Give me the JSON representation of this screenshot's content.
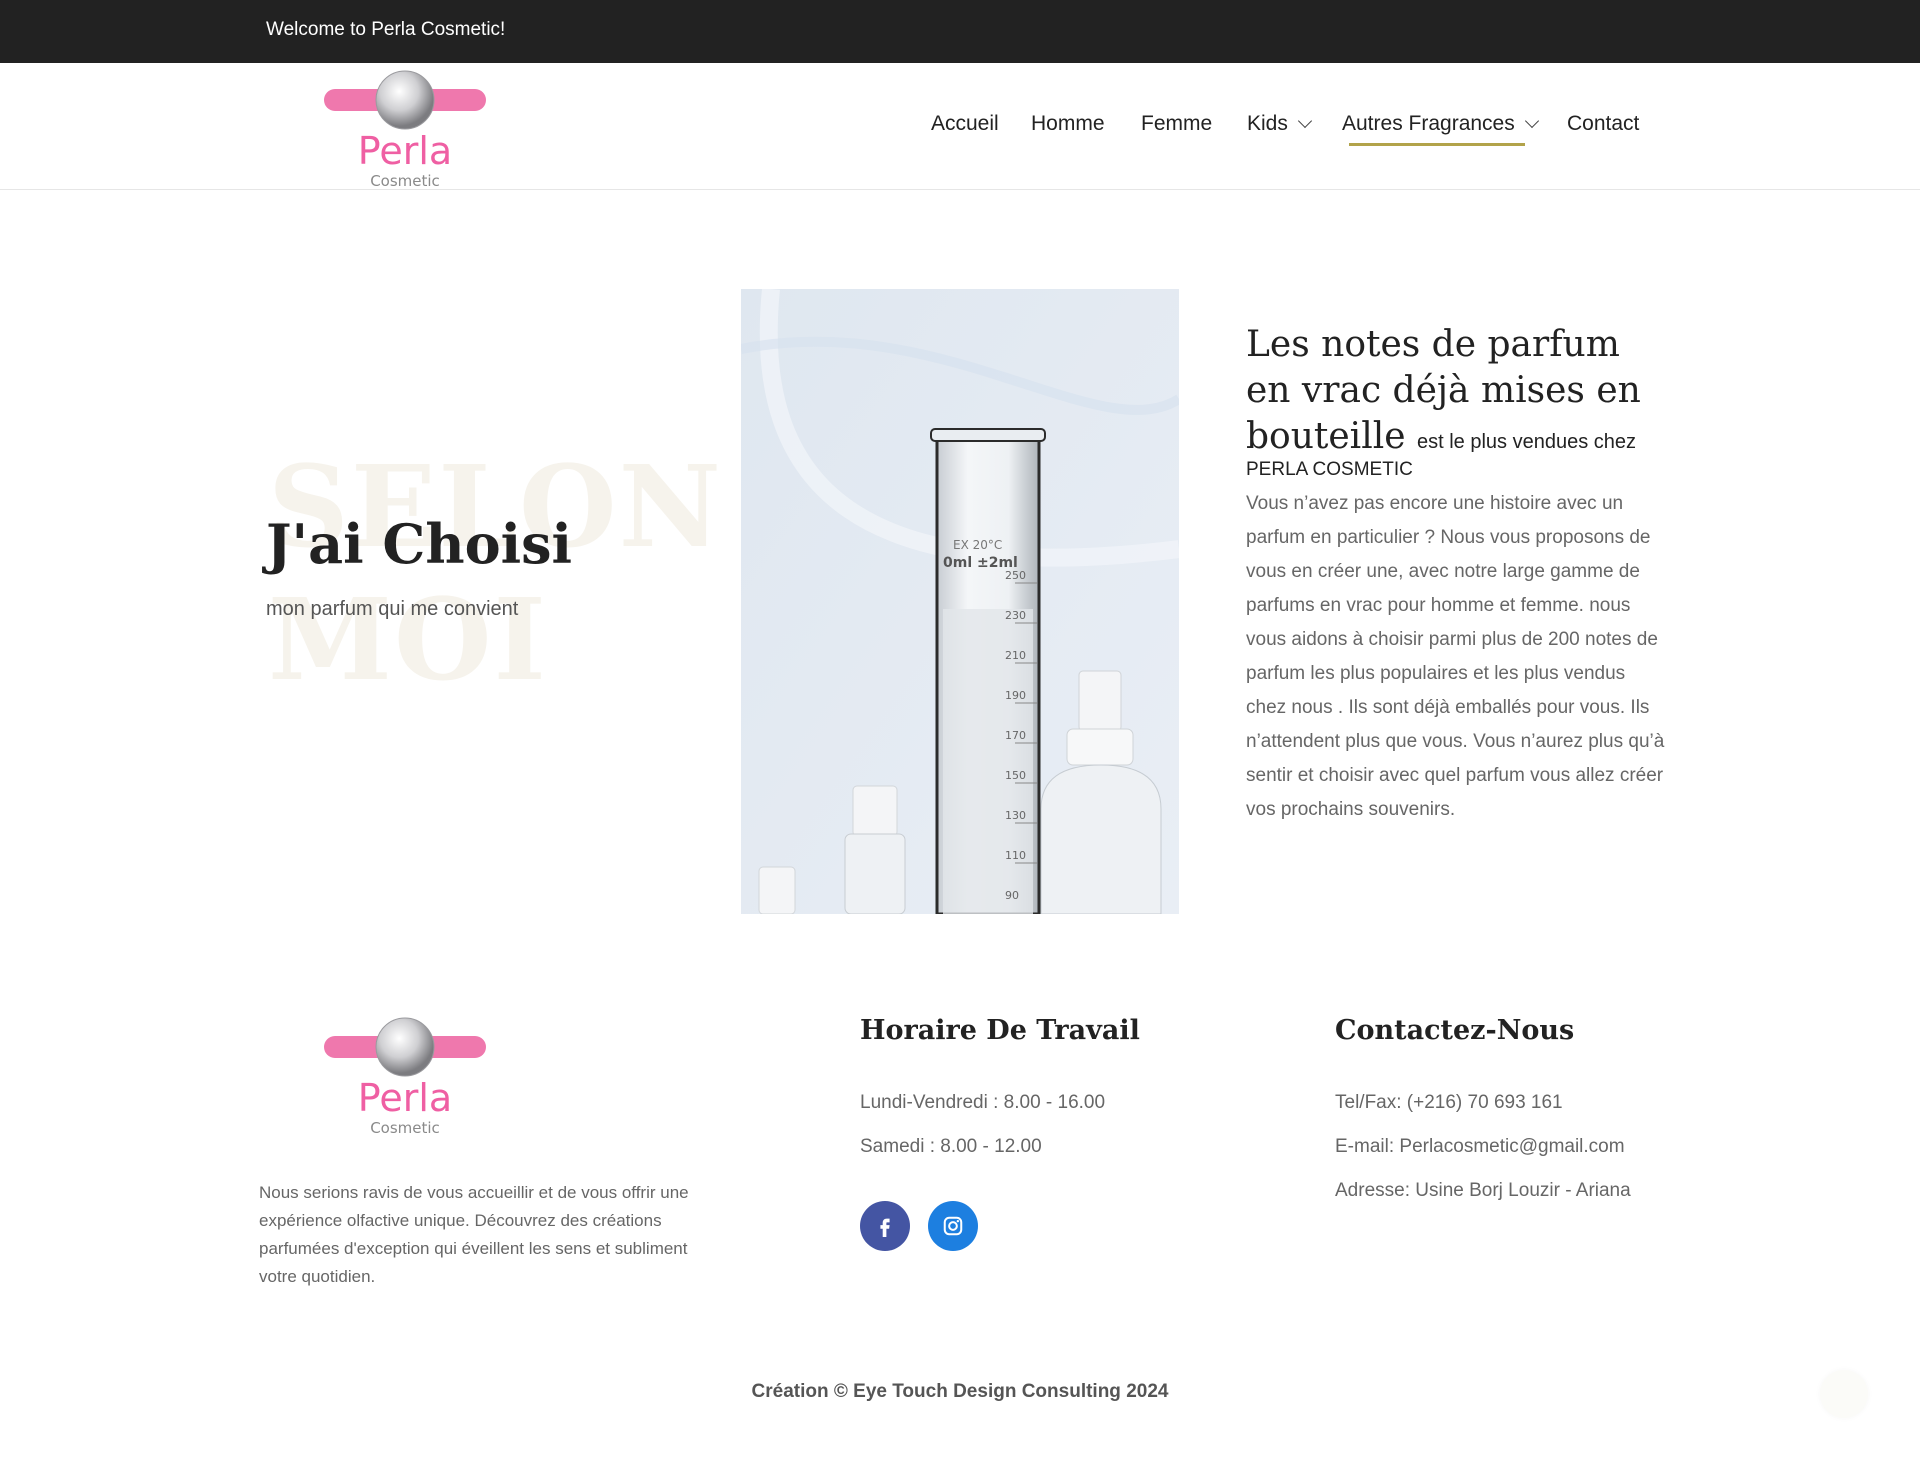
{
  "topbar": {
    "welcome": "Welcome to Perla Cosmetic!"
  },
  "brand": {
    "name": "Perla",
    "tagline": "Cosmetic",
    "pink": "#ef78ad",
    "accent": "#b2a34a"
  },
  "nav": {
    "items": [
      {
        "label": "Accueil",
        "dropdown": false
      },
      {
        "label": "Homme",
        "dropdown": false
      },
      {
        "label": "Femme",
        "dropdown": false
      },
      {
        "label": "Kids",
        "dropdown": true
      },
      {
        "label": "Autres Fragrances",
        "dropdown": true,
        "active": true
      },
      {
        "label": "Contact",
        "dropdown": false
      }
    ]
  },
  "hero": {
    "ghost_line1": "SELON",
    "ghost_line2": "MOI",
    "title": "J'ai Choisi",
    "subtitle": "mon parfum qui me convient"
  },
  "notes": {
    "title": "Les notes de parfum en vrac déjà mises en bouteille",
    "title_suffix": "est le plus vendues chez",
    "brand": "PERLA COSMETIC",
    "body": "Vous n’avez pas encore une histoire avec un parfum en particulier ? Nous vous proposons de vous en créer une, avec notre large gamme de parfums en vrac pour homme et femme. nous vous aidons à choisir parmi plus de 200 notes de parfum les plus populaires et les plus vendus chez nous . Ils sont déjà emballés pour vous. Ils n’attendent plus que vous. Vous n’aurez plus qu’à sentir et choisir avec quel parfum vous allez créer vos prochains souvenirs."
  },
  "footer": {
    "about": "Nous serions ravis de vous accueillir et de vous offrir une expérience olfactive unique. Découvrez des créations parfumées d'exception qui éveillent les sens et subliment votre quotidien.",
    "hours": {
      "heading": "Horaire De Travail",
      "weekdays": "Lundi-Vendredi : 8.00 - 16.00",
      "saturday": "Samedi : 8.00 - 12.00"
    },
    "social": [
      {
        "icon": "facebook-icon",
        "color": "#4455a3"
      },
      {
        "icon": "instagram-icon",
        "color": "#1d7fe0"
      }
    ],
    "contact": {
      "heading": "Contactez-Nous",
      "tel": "Tel/Fax: (+216) 70 693 161",
      "email": "E-mail: Perlacosmetic@gmail.com",
      "address": "Adresse: Usine Borj Louzir - Ariana"
    },
    "copyright": "Création © Eye Touch Design Consulting 2024"
  }
}
